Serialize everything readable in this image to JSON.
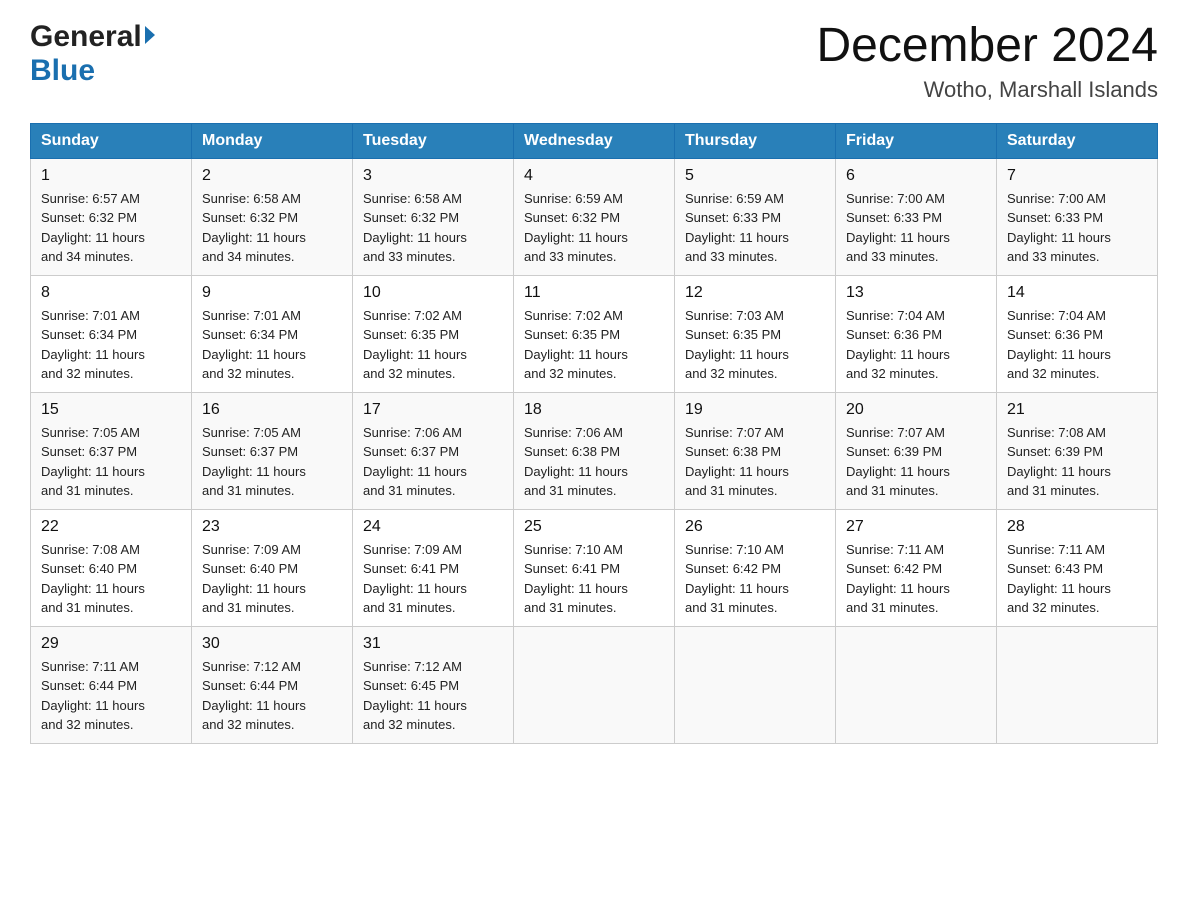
{
  "header": {
    "logo_general": "General",
    "logo_blue": "Blue",
    "title": "December 2024",
    "subtitle": "Wotho, Marshall Islands"
  },
  "days_of_week": [
    "Sunday",
    "Monday",
    "Tuesday",
    "Wednesday",
    "Thursday",
    "Friday",
    "Saturday"
  ],
  "weeks": [
    [
      {
        "day": "1",
        "sunrise": "6:57 AM",
        "sunset": "6:32 PM",
        "daylight": "11 hours and 34 minutes."
      },
      {
        "day": "2",
        "sunrise": "6:58 AM",
        "sunset": "6:32 PM",
        "daylight": "11 hours and 34 minutes."
      },
      {
        "day": "3",
        "sunrise": "6:58 AM",
        "sunset": "6:32 PM",
        "daylight": "11 hours and 33 minutes."
      },
      {
        "day": "4",
        "sunrise": "6:59 AM",
        "sunset": "6:32 PM",
        "daylight": "11 hours and 33 minutes."
      },
      {
        "day": "5",
        "sunrise": "6:59 AM",
        "sunset": "6:33 PM",
        "daylight": "11 hours and 33 minutes."
      },
      {
        "day": "6",
        "sunrise": "7:00 AM",
        "sunset": "6:33 PM",
        "daylight": "11 hours and 33 minutes."
      },
      {
        "day": "7",
        "sunrise": "7:00 AM",
        "sunset": "6:33 PM",
        "daylight": "11 hours and 33 minutes."
      }
    ],
    [
      {
        "day": "8",
        "sunrise": "7:01 AM",
        "sunset": "6:34 PM",
        "daylight": "11 hours and 32 minutes."
      },
      {
        "day": "9",
        "sunrise": "7:01 AM",
        "sunset": "6:34 PM",
        "daylight": "11 hours and 32 minutes."
      },
      {
        "day": "10",
        "sunrise": "7:02 AM",
        "sunset": "6:35 PM",
        "daylight": "11 hours and 32 minutes."
      },
      {
        "day": "11",
        "sunrise": "7:02 AM",
        "sunset": "6:35 PM",
        "daylight": "11 hours and 32 minutes."
      },
      {
        "day": "12",
        "sunrise": "7:03 AM",
        "sunset": "6:35 PM",
        "daylight": "11 hours and 32 minutes."
      },
      {
        "day": "13",
        "sunrise": "7:04 AM",
        "sunset": "6:36 PM",
        "daylight": "11 hours and 32 minutes."
      },
      {
        "day": "14",
        "sunrise": "7:04 AM",
        "sunset": "6:36 PM",
        "daylight": "11 hours and 32 minutes."
      }
    ],
    [
      {
        "day": "15",
        "sunrise": "7:05 AM",
        "sunset": "6:37 PM",
        "daylight": "11 hours and 31 minutes."
      },
      {
        "day": "16",
        "sunrise": "7:05 AM",
        "sunset": "6:37 PM",
        "daylight": "11 hours and 31 minutes."
      },
      {
        "day": "17",
        "sunrise": "7:06 AM",
        "sunset": "6:37 PM",
        "daylight": "11 hours and 31 minutes."
      },
      {
        "day": "18",
        "sunrise": "7:06 AM",
        "sunset": "6:38 PM",
        "daylight": "11 hours and 31 minutes."
      },
      {
        "day": "19",
        "sunrise": "7:07 AM",
        "sunset": "6:38 PM",
        "daylight": "11 hours and 31 minutes."
      },
      {
        "day": "20",
        "sunrise": "7:07 AM",
        "sunset": "6:39 PM",
        "daylight": "11 hours and 31 minutes."
      },
      {
        "day": "21",
        "sunrise": "7:08 AM",
        "sunset": "6:39 PM",
        "daylight": "11 hours and 31 minutes."
      }
    ],
    [
      {
        "day": "22",
        "sunrise": "7:08 AM",
        "sunset": "6:40 PM",
        "daylight": "11 hours and 31 minutes."
      },
      {
        "day": "23",
        "sunrise": "7:09 AM",
        "sunset": "6:40 PM",
        "daylight": "11 hours and 31 minutes."
      },
      {
        "day": "24",
        "sunrise": "7:09 AM",
        "sunset": "6:41 PM",
        "daylight": "11 hours and 31 minutes."
      },
      {
        "day": "25",
        "sunrise": "7:10 AM",
        "sunset": "6:41 PM",
        "daylight": "11 hours and 31 minutes."
      },
      {
        "day": "26",
        "sunrise": "7:10 AM",
        "sunset": "6:42 PM",
        "daylight": "11 hours and 31 minutes."
      },
      {
        "day": "27",
        "sunrise": "7:11 AM",
        "sunset": "6:42 PM",
        "daylight": "11 hours and 31 minutes."
      },
      {
        "day": "28",
        "sunrise": "7:11 AM",
        "sunset": "6:43 PM",
        "daylight": "11 hours and 32 minutes."
      }
    ],
    [
      {
        "day": "29",
        "sunrise": "7:11 AM",
        "sunset": "6:44 PM",
        "daylight": "11 hours and 32 minutes."
      },
      {
        "day": "30",
        "sunrise": "7:12 AM",
        "sunset": "6:44 PM",
        "daylight": "11 hours and 32 minutes."
      },
      {
        "day": "31",
        "sunrise": "7:12 AM",
        "sunset": "6:45 PM",
        "daylight": "11 hours and 32 minutes."
      },
      null,
      null,
      null,
      null
    ]
  ],
  "labels": {
    "sunrise": "Sunrise:",
    "sunset": "Sunset:",
    "daylight": "Daylight:"
  }
}
